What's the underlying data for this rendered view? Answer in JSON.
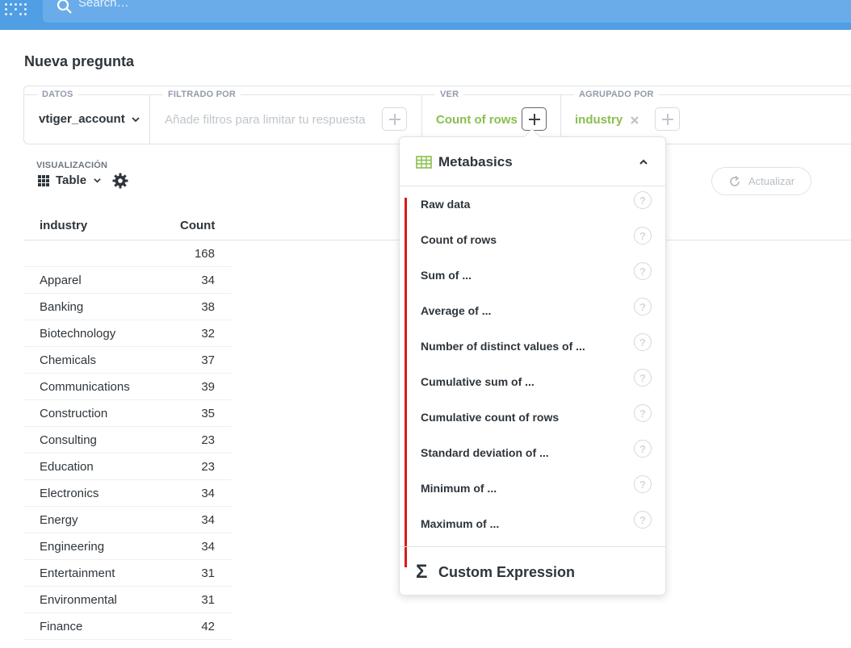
{
  "nav": {
    "search_placeholder": "Search…"
  },
  "page": {
    "title": "Nueva pregunta"
  },
  "query_builder": {
    "data_label": "DATOS",
    "data_value": "vtiger_account",
    "filter_label": "FILTRADO POR",
    "filter_placeholder": "Añade filtros para limitar tu respuesta",
    "view_label": "VER",
    "view_value": "Count of rows",
    "group_label": "AGRUPADO POR",
    "group_value": "industry",
    "accent_color": "#88bf4d"
  },
  "visualization": {
    "label": "VISUALIZACIÓN",
    "type": "Table"
  },
  "refresh_label": "Actualizar",
  "table": {
    "headers": [
      "industry",
      "Count"
    ],
    "rows": [
      [
        "",
        "168"
      ],
      [
        "Apparel",
        "34"
      ],
      [
        "Banking",
        "38"
      ],
      [
        "Biotechnology",
        "32"
      ],
      [
        "Chemicals",
        "37"
      ],
      [
        "Communications",
        "39"
      ],
      [
        "Construction",
        "35"
      ],
      [
        "Consulting",
        "23"
      ],
      [
        "Education",
        "23"
      ],
      [
        "Electronics",
        "34"
      ],
      [
        "Energy",
        "34"
      ],
      [
        "Engineering",
        "34"
      ],
      [
        "Entertainment",
        "31"
      ],
      [
        "Environmental",
        "31"
      ],
      [
        "Finance",
        "42"
      ]
    ]
  },
  "popover": {
    "section_title": "Metabasics",
    "items": [
      "Raw data",
      "Count of rows",
      "Sum of ...",
      "Average of ...",
      "Number of distinct values of ...",
      "Cumulative sum of ...",
      "Cumulative count of rows",
      "Standard deviation of ...",
      "Minimum of ...",
      "Maximum of ..."
    ],
    "custom_expression": "Custom Expression",
    "help_glyph": "?"
  }
}
